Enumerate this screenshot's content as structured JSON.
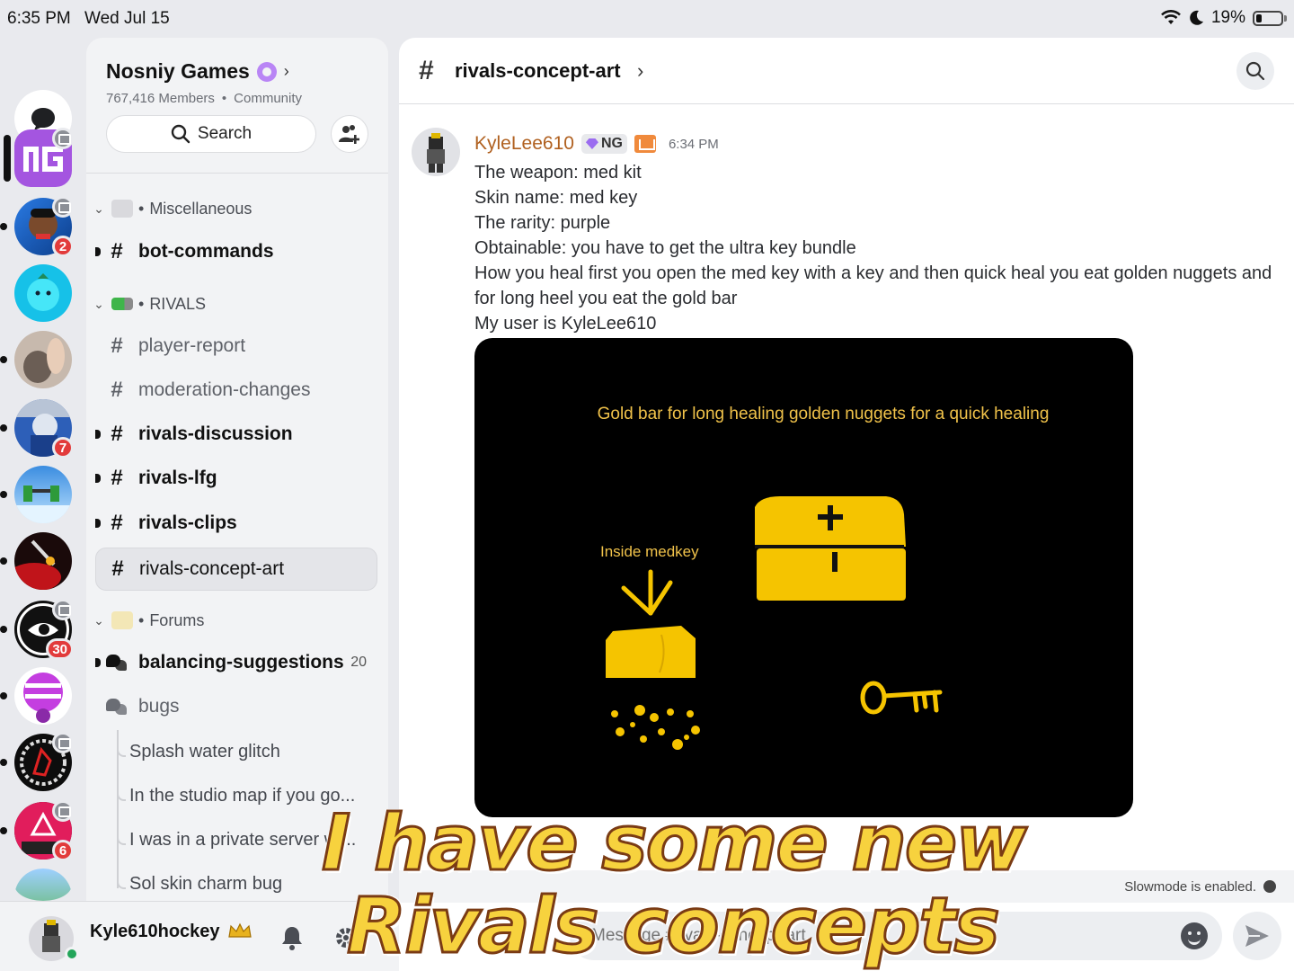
{
  "status_bar": {
    "time": "6:35 PM",
    "date": "Wed Jul 15",
    "battery": "19%"
  },
  "server_rail": {
    "servers": [
      {
        "name": "Nosniy Games",
        "badge": ""
      },
      {
        "name": "server-2",
        "badge": "2"
      },
      {
        "name": "server-3",
        "badge": ""
      },
      {
        "name": "server-4",
        "badge": ""
      },
      {
        "name": "server-5",
        "badge": "7"
      },
      {
        "name": "server-6",
        "badge": ""
      },
      {
        "name": "server-7",
        "badge": ""
      },
      {
        "name": "server-8",
        "badge": "30"
      },
      {
        "name": "server-9",
        "badge": ""
      },
      {
        "name": "server-10",
        "badge": ""
      },
      {
        "name": "server-11",
        "badge": "6"
      }
    ]
  },
  "guild": {
    "name": "Nosniy Games",
    "members": "767,416 Members",
    "type": "Community",
    "search_label": "Search"
  },
  "channels": {
    "categories": [
      {
        "name": "Miscellaneous"
      },
      {
        "name": "RIVALS"
      },
      {
        "name": "Forums"
      }
    ],
    "items": [
      {
        "name": "bot-commands"
      },
      {
        "name": "player-report"
      },
      {
        "name": "moderation-changes"
      },
      {
        "name": "rivals-discussion"
      },
      {
        "name": "rivals-lfg"
      },
      {
        "name": "rivals-clips"
      },
      {
        "name": "rivals-concept-art"
      },
      {
        "name": "balancing-suggestions",
        "count": "20"
      },
      {
        "name": "bugs"
      }
    ],
    "threads": [
      "Splash water glitch",
      "In the studio map if you go...",
      "I was in a private server wi...",
      "Sol skin charm bug"
    ]
  },
  "user": {
    "name": "Kyle610hockey"
  },
  "channel_header": {
    "title": "rivals-concept-art"
  },
  "message": {
    "author": "KyleLee610",
    "clan_tag": "NG",
    "timestamp": "6:34 PM",
    "lines": [
      "The weapon: med kit",
      "Skin name: med key",
      "The rarity: purple",
      "Obtainable: you have to get the ultra key bundle",
      "How you heal first you open the med key with a key and then quick heal you eat golden nuggets and",
      "for long heel you eat the gold bar",
      "My user is KyleLee610"
    ],
    "attachment": {
      "caption_top": "Gold bar for long healing golden nuggets for a quick healing",
      "caption_inside": "Inside medkey"
    }
  },
  "slowmode_text": "Slowmode is enabled.",
  "composer": {
    "placeholder": "Message #rivals-concept-art"
  },
  "overlay_caption": {
    "line1": "I have some new",
    "line2": "Rivals concepts"
  },
  "colors": {
    "accent_online": "#23a55a",
    "badge_red": "#e23b3b",
    "author_orange": "#b0601f",
    "drawing_yellow": "#f5c400"
  }
}
